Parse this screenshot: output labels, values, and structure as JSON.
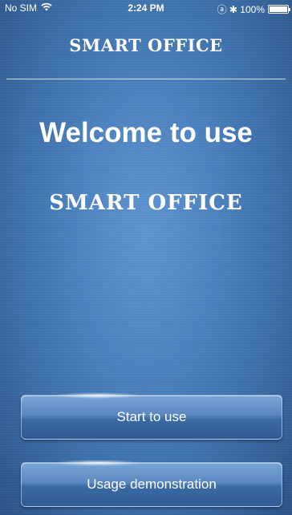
{
  "status_bar": {
    "carrier": "No SIM",
    "wifi_icon": "wifi-icon",
    "time": "2:24 PM",
    "right_text": "ⓐ ✱ 100%",
    "battery_percent": 100
  },
  "header": {
    "title": "SMART OFFICE"
  },
  "main": {
    "welcome_text": "Welcome to use",
    "brand_text": "SMART OFFICE"
  },
  "buttons": {
    "start_label": "Start to use",
    "demo_label": "Usage demonstration"
  },
  "colors": {
    "background": "#4b82c0",
    "text": "#ffffff"
  }
}
